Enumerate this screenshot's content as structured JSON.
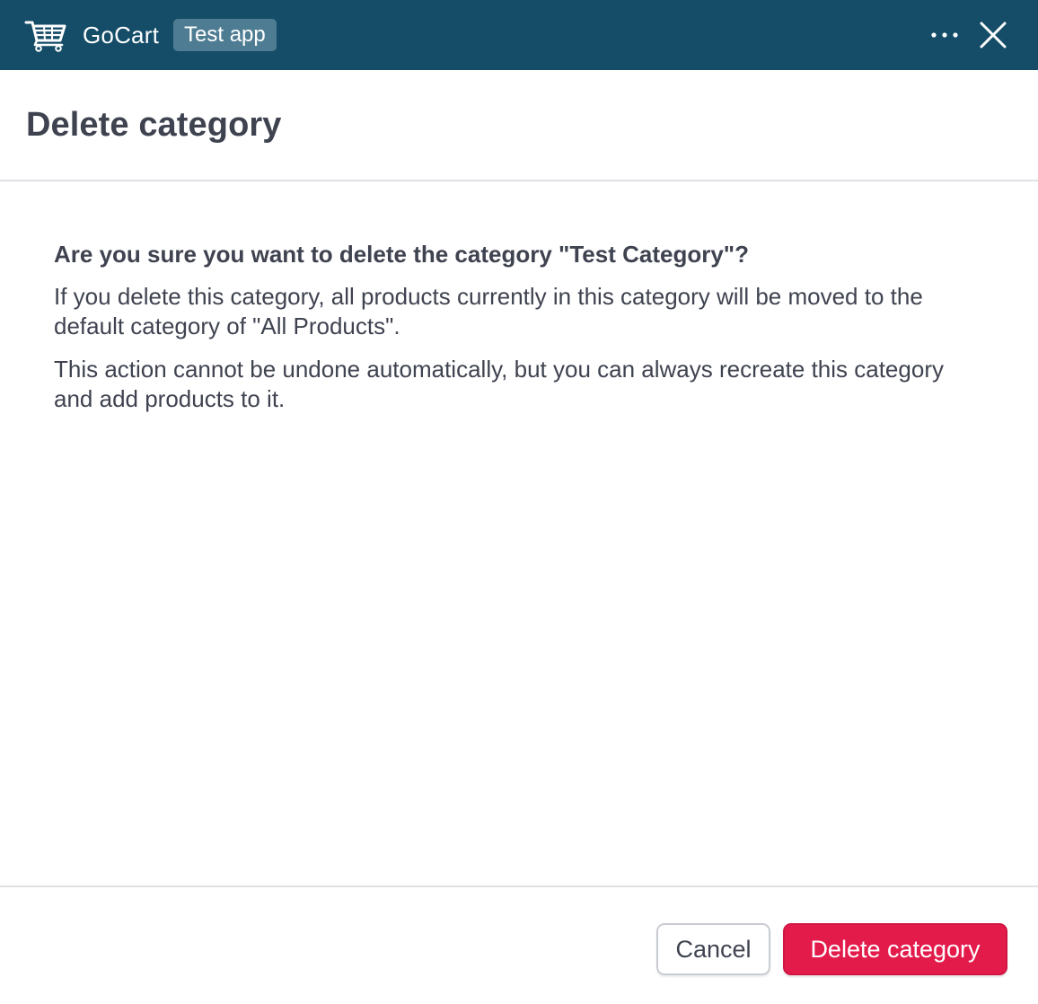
{
  "topbar": {
    "brand_name": "GoCart",
    "env_badge": "Test app",
    "brand_icon": "cart-icon",
    "more_icon": "more-horizontal-icon",
    "close_icon": "close-icon",
    "background_color": "#154d68"
  },
  "header": {
    "title": "Delete category"
  },
  "body": {
    "question": "Are you sure you want to delete the category \"Test Category\"?",
    "paragraph_1": "If you delete this category, all products currently in this category will be moved to the default category of \"All Products\".",
    "paragraph_2": "This action cannot be undone automatically, but you can always recreate this category and add products to it."
  },
  "footer": {
    "cancel_label": "Cancel",
    "delete_label": "Delete category",
    "delete_color": "#e31b4b"
  }
}
